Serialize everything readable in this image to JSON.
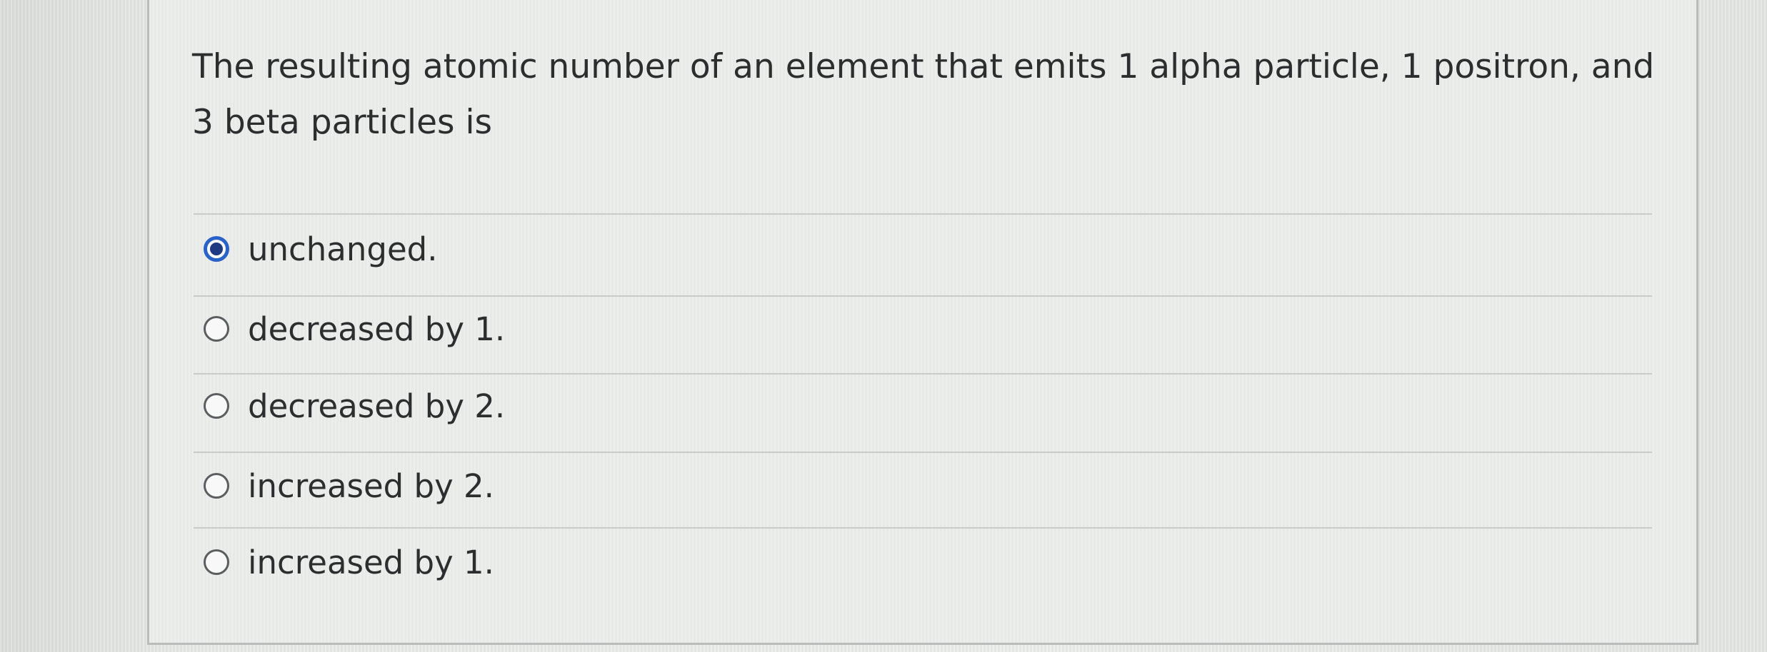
{
  "question": {
    "text": "The resulting atomic number of an element that emits 1 alpha particle, 1 positron, and 3 beta particles is"
  },
  "options": [
    {
      "label": "unchanged.",
      "selected": true
    },
    {
      "label": "decreased by 1.",
      "selected": false
    },
    {
      "label": "decreased by 2.",
      "selected": false
    },
    {
      "label": "increased by 2.",
      "selected": false
    },
    {
      "label": "increased by 1.",
      "selected": false
    }
  ],
  "colors": {
    "selected_radio": "#2a63c8",
    "text": "#2b2d2e",
    "divider": "#c8cbc9"
  }
}
